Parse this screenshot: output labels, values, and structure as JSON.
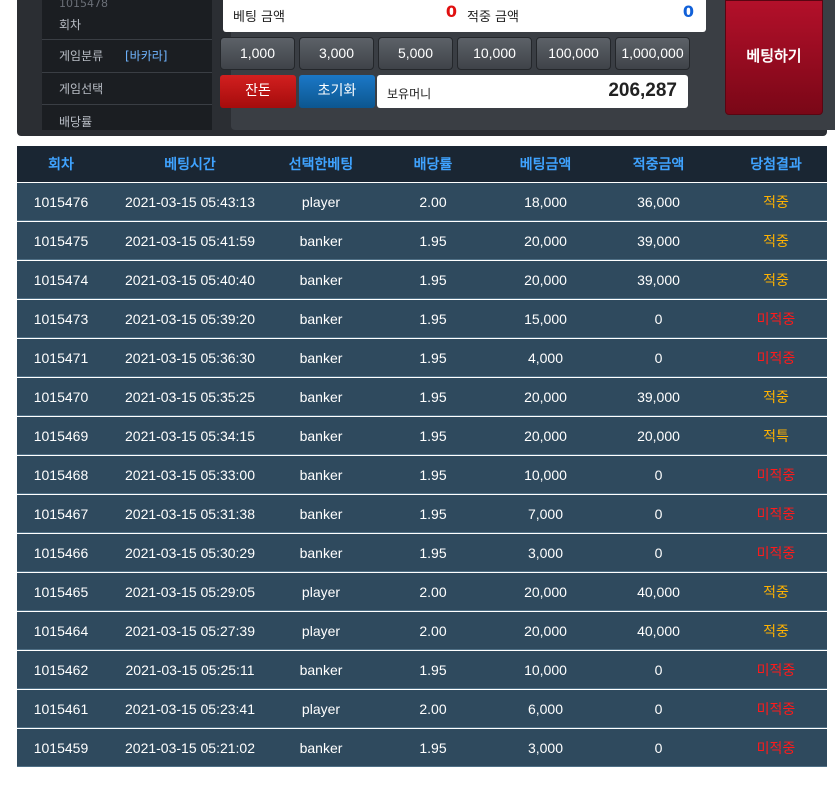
{
  "info": {
    "round_faded": "1015478",
    "round_label": "회차",
    "game_class_label": "게임분류",
    "game_class_value": "[바카라]",
    "game_select_label": "게임선택",
    "odds_label": "배당률"
  },
  "bet": {
    "bet_amount_label": "베팅 금액",
    "bet_amount_value": "0",
    "win_amount_label": "적중 금액",
    "win_amount_value": "0",
    "chips": [
      "1,000",
      "3,000",
      "5,000",
      "10,000",
      "100,000",
      "1,000,000"
    ],
    "remainder_label": "잔돈",
    "reset_label": "초기화",
    "balance_label": "보유머니",
    "balance_value": "206,287",
    "bet_button_label": "베팅하기"
  },
  "table": {
    "headers": [
      "회차",
      "베팅시간",
      "선택한베팅",
      "배당률",
      "베팅금액",
      "적중금액",
      "당첨결과"
    ],
    "rows": [
      [
        "1015476",
        "2021-03-15 05:43:13",
        "player",
        "2.00",
        "18,000",
        "36,000",
        "적중"
      ],
      [
        "1015475",
        "2021-03-15 05:41:59",
        "banker",
        "1.95",
        "20,000",
        "39,000",
        "적중"
      ],
      [
        "1015474",
        "2021-03-15 05:40:40",
        "banker",
        "1.95",
        "20,000",
        "39,000",
        "적중"
      ],
      [
        "1015473",
        "2021-03-15 05:39:20",
        "banker",
        "1.95",
        "15,000",
        "0",
        "미적중"
      ],
      [
        "1015471",
        "2021-03-15 05:36:30",
        "banker",
        "1.95",
        "4,000",
        "0",
        "미적중"
      ],
      [
        "1015470",
        "2021-03-15 05:35:25",
        "banker",
        "1.95",
        "20,000",
        "39,000",
        "적중"
      ],
      [
        "1015469",
        "2021-03-15 05:34:15",
        "banker",
        "1.95",
        "20,000",
        "20,000",
        "적특"
      ],
      [
        "1015468",
        "2021-03-15 05:33:00",
        "banker",
        "1.95",
        "10,000",
        "0",
        "미적중"
      ],
      [
        "1015467",
        "2021-03-15 05:31:38",
        "banker",
        "1.95",
        "7,000",
        "0",
        "미적중"
      ],
      [
        "1015466",
        "2021-03-15 05:30:29",
        "banker",
        "1.95",
        "3,000",
        "0",
        "미적중"
      ],
      [
        "1015465",
        "2021-03-15 05:29:05",
        "player",
        "2.00",
        "20,000",
        "40,000",
        "적중"
      ],
      [
        "1015464",
        "2021-03-15 05:27:39",
        "player",
        "2.00",
        "20,000",
        "40,000",
        "적중"
      ],
      [
        "1015462",
        "2021-03-15 05:25:11",
        "banker",
        "1.95",
        "10,000",
        "0",
        "미적중"
      ],
      [
        "1015461",
        "2021-03-15 05:23:41",
        "player",
        "2.00",
        "6,000",
        "0",
        "미적중"
      ],
      [
        "1015459",
        "2021-03-15 05:21:02",
        "banker",
        "1.95",
        "3,000",
        "0",
        "미적중"
      ]
    ]
  },
  "colors": {
    "accent_blue": "#3fa3ff",
    "win": "#ffb200",
    "lose": "#ff1a1a",
    "bet_amount": "#e01010",
    "win_amount": "#1160d8"
  }
}
